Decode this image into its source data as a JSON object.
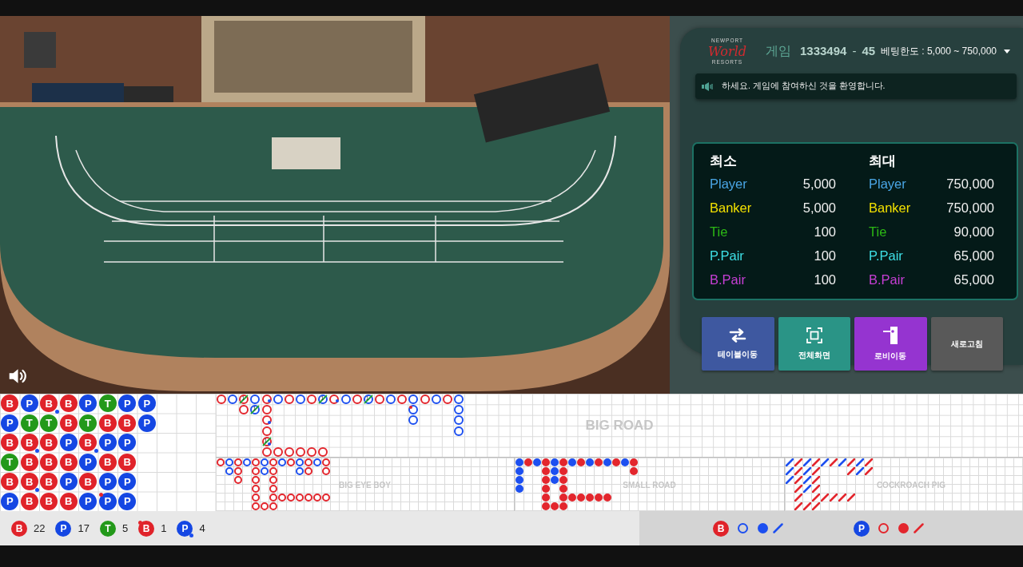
{
  "header": {
    "logo": {
      "top": "NEWPORT",
      "script": "World",
      "bottom": "RESORTS"
    },
    "game_label": "게임",
    "game_number": "1333494",
    "separator": "-",
    "round": "45",
    "bet_limit": "베팅한도 : 5,000 ~ 750,000"
  },
  "notice": {
    "text": "하세요. 게임에 참여하신 것을 환영합니다."
  },
  "limits": [
    {
      "heading": "최소",
      "rows": [
        {
          "label": "Player",
          "color": "#4aa6e6",
          "value": "5,000"
        },
        {
          "label": "Banker",
          "color": "#f2e000",
          "value": "5,000"
        },
        {
          "label": "Tie",
          "color": "#2cb815",
          "value": "100"
        },
        {
          "label": "P.Pair",
          "color": "#3ee0e6",
          "value": "100"
        },
        {
          "label": "B.Pair",
          "color": "#c83fd6",
          "value": "100"
        }
      ]
    },
    {
      "heading": "최대",
      "rows": [
        {
          "label": "Player",
          "color": "#4aa6e6",
          "value": "750,000"
        },
        {
          "label": "Banker",
          "color": "#f2e000",
          "value": "750,000"
        },
        {
          "label": "Tie",
          "color": "#2cb815",
          "value": "90,000"
        },
        {
          "label": "P.Pair",
          "color": "#3ee0e6",
          "value": "65,000"
        },
        {
          "label": "B.Pair",
          "color": "#c83fd6",
          "value": "65,000"
        }
      ]
    }
  ],
  "buttons": [
    {
      "label": "테이블이동",
      "kind": "swap",
      "color": "#3e58a0"
    },
    {
      "label": "전체화면",
      "kind": "fullscreen",
      "color": "#2a9486"
    },
    {
      "label": "로비이동",
      "kind": "exit",
      "color": "#9534d0"
    },
    {
      "label": "새로고침",
      "kind": "text",
      "color": "#595959"
    }
  ],
  "bead_road": {
    "columns": [
      [
        {
          "label": "B",
          "kind": "banker",
          "banker_pair": false,
          "player_pair": false
        },
        {
          "label": "P",
          "kind": "player",
          "banker_pair": false,
          "player_pair": false
        },
        {
          "label": "B",
          "kind": "banker",
          "banker_pair": false,
          "player_pair": false
        },
        {
          "label": "T",
          "kind": "tie",
          "banker_pair": false,
          "player_pair": false
        },
        {
          "label": "B",
          "kind": "banker",
          "banker_pair": false,
          "player_pair": false
        },
        {
          "label": "P",
          "kind": "player",
          "banker_pair": false,
          "player_pair": false
        }
      ],
      [
        {
          "label": "P",
          "kind": "player",
          "banker_pair": false,
          "player_pair": false
        },
        {
          "label": "T",
          "kind": "tie",
          "banker_pair": false,
          "player_pair": false
        },
        {
          "label": "B",
          "kind": "banker",
          "banker_pair": false,
          "player_pair": true
        },
        {
          "label": "B",
          "kind": "banker",
          "banker_pair": false,
          "player_pair": false
        },
        {
          "label": "B",
          "kind": "banker",
          "banker_pair": false,
          "player_pair": true
        },
        {
          "label": "B",
          "kind": "banker",
          "banker_pair": false,
          "player_pair": false
        }
      ],
      [
        {
          "label": "B",
          "kind": "banker",
          "banker_pair": false,
          "player_pair": true
        },
        {
          "label": "T",
          "kind": "tie",
          "banker_pair": false,
          "player_pair": false
        },
        {
          "label": "B",
          "kind": "banker",
          "banker_pair": false,
          "player_pair": false
        },
        {
          "label": "B",
          "kind": "banker",
          "banker_pair": false,
          "player_pair": false
        },
        {
          "label": "B",
          "kind": "banker",
          "banker_pair": false,
          "player_pair": false
        },
        {
          "label": "B",
          "kind": "banker",
          "banker_pair": false,
          "player_pair": false
        }
      ],
      [
        {
          "label": "B",
          "kind": "banker",
          "banker_pair": false,
          "player_pair": false
        },
        {
          "label": "B",
          "kind": "banker",
          "banker_pair": false,
          "player_pair": false
        },
        {
          "label": "P",
          "kind": "player",
          "banker_pair": false,
          "player_pair": false
        },
        {
          "label": "B",
          "kind": "banker",
          "banker_pair": false,
          "player_pair": false
        },
        {
          "label": "P",
          "kind": "player",
          "banker_pair": false,
          "player_pair": false
        },
        {
          "label": "B",
          "kind": "banker",
          "banker_pair": false,
          "player_pair": false
        }
      ],
      [
        {
          "label": "P",
          "kind": "player",
          "banker_pair": false,
          "player_pair": false
        },
        {
          "label": "T",
          "kind": "tie",
          "banker_pair": false,
          "player_pair": false
        },
        {
          "label": "B",
          "kind": "banker",
          "banker_pair": false,
          "player_pair": true
        },
        {
          "label": "P",
          "kind": "player",
          "banker_pair": false,
          "player_pair": false
        },
        {
          "label": "B",
          "kind": "banker",
          "banker_pair": false,
          "player_pair": false
        },
        {
          "label": "P",
          "kind": "player",
          "banker_pair": false,
          "player_pair": false
        }
      ],
      [
        {
          "label": "T",
          "kind": "tie",
          "banker_pair": false,
          "player_pair": false
        },
        {
          "label": "B",
          "kind": "banker",
          "banker_pair": false,
          "player_pair": false
        },
        {
          "label": "P",
          "kind": "player",
          "banker_pair": false,
          "player_pair": false
        },
        {
          "label": "B",
          "kind": "banker",
          "banker_pair": false,
          "player_pair": false
        },
        {
          "label": "P",
          "kind": "player",
          "banker_pair": false,
          "player_pair": false
        },
        {
          "label": "P",
          "kind": "player",
          "banker_pair": true,
          "player_pair": false
        }
      ],
      [
        {
          "label": "P",
          "kind": "player",
          "banker_pair": false,
          "player_pair": false
        },
        {
          "label": "B",
          "kind": "banker",
          "banker_pair": false,
          "player_pair": false
        },
        {
          "label": "P",
          "kind": "player",
          "banker_pair": false,
          "player_pair": false
        },
        {
          "label": "B",
          "kind": "banker",
          "banker_pair": false,
          "player_pair": false
        },
        {
          "label": "P",
          "kind": "player",
          "banker_pair": false,
          "player_pair": false
        },
        {
          "label": "P",
          "kind": "player",
          "banker_pair": false,
          "player_pair": false
        }
      ],
      [
        {
          "label": "P",
          "kind": "player",
          "banker_pair": false,
          "player_pair": false
        },
        {
          "label": "P",
          "kind": "player",
          "banker_pair": false,
          "player_pair": false
        }
      ]
    ]
  },
  "big_road": {
    "label": "BIG ROAD",
    "columns": [
      [
        {
          "kind": "banker",
          "banker_pair": false,
          "player_pair": false
        }
      ],
      [
        {
          "kind": "player",
          "banker_pair": false,
          "player_pair": false
        }
      ],
      [
        {
          "kind": "banker",
          "tie": "1",
          "banker_pair": false,
          "player_pair": false
        },
        {
          "kind": "banker",
          "banker_pair": false,
          "player_pair": false
        }
      ],
      [
        {
          "kind": "player",
          "banker_pair": false,
          "player_pair": false
        },
        {
          "kind": "player",
          "tie": "1",
          "banker_pair": false,
          "player_pair": false
        }
      ],
      [
        {
          "kind": "banker",
          "banker_pair": false,
          "player_pair": true
        },
        {
          "kind": "banker",
          "banker_pair": false,
          "player_pair": false
        },
        {
          "kind": "banker",
          "banker_pair": false,
          "player_pair": true
        },
        {
          "kind": "banker",
          "banker_pair": false,
          "player_pair": false
        },
        {
          "kind": "banker",
          "tie": "1",
          "banker_pair": false,
          "player_pair": true
        },
        {
          "kind": "banker",
          "banker_pair": false,
          "player_pair": false
        },
        {
          "kind": "banker",
          "banker_pair": false,
          "player_pair": false
        },
        {
          "kind": "banker",
          "banker_pair": false,
          "player_pair": false
        },
        {
          "kind": "banker",
          "banker_pair": false,
          "player_pair": false
        },
        {
          "kind": "banker",
          "banker_pair": false,
          "player_pair": false
        },
        {
          "kind": "banker",
          "banker_pair": false,
          "player_pair": false
        }
      ],
      [
        {
          "kind": "player",
          "banker_pair": false,
          "player_pair": false
        }
      ],
      [
        {
          "kind": "banker",
          "banker_pair": false,
          "player_pair": false
        }
      ],
      [
        {
          "kind": "player",
          "banker_pair": false,
          "player_pair": false
        }
      ],
      [
        {
          "kind": "banker",
          "banker_pair": false,
          "player_pair": false
        }
      ],
      [
        {
          "kind": "player",
          "tie": "1",
          "banker_pair": false,
          "player_pair": false
        }
      ],
      [
        {
          "kind": "banker",
          "banker_pair": false,
          "player_pair": true
        }
      ],
      [
        {
          "kind": "player",
          "banker_pair": false,
          "player_pair": false
        }
      ],
      [
        {
          "kind": "banker",
          "banker_pair": false,
          "player_pair": false
        }
      ],
      [
        {
          "kind": "player",
          "tie": "1",
          "banker_pair": false,
          "player_pair": false
        }
      ],
      [
        {
          "kind": "banker",
          "banker_pair": false,
          "player_pair": false
        }
      ],
      [
        {
          "kind": "player",
          "banker_pair": false,
          "player_pair": false
        }
      ],
      [
        {
          "kind": "banker",
          "banker_pair": false,
          "player_pair": false
        }
      ],
      [
        {
          "kind": "player",
          "banker_pair": false,
          "player_pair": false
        },
        {
          "kind": "player",
          "banker_pair": true,
          "player_pair": false
        },
        {
          "kind": "player",
          "banker_pair": false,
          "player_pair": false
        }
      ],
      [
        {
          "kind": "banker",
          "banker_pair": false,
          "player_pair": false
        }
      ],
      [
        {
          "kind": "player",
          "banker_pair": false,
          "player_pair": false
        }
      ],
      [
        {
          "kind": "banker",
          "banker_pair": false,
          "player_pair": false
        }
      ],
      [
        {
          "kind": "player",
          "banker_pair": false,
          "player_pair": false
        },
        {
          "kind": "player",
          "banker_pair": false,
          "player_pair": false
        },
        {
          "kind": "player",
          "banker_pair": false,
          "player_pair": false
        },
        {
          "kind": "player",
          "banker_pair": false,
          "player_pair": false
        }
      ]
    ]
  },
  "big_eye_boy": {
    "label": "BIG EYE BOY",
    "columns": [
      [
        {
          "color": "#e3262d"
        }
      ],
      [
        {
          "color": "#1c4ff0"
        },
        {
          "color": "#1c4ff0"
        }
      ],
      [
        {
          "color": "#e3262d"
        },
        {
          "color": "#e3262d"
        },
        {
          "color": "#e3262d"
        }
      ],
      [
        {
          "color": "#1c4ff0"
        }
      ],
      [
        {
          "color": "#e3262d"
        },
        {
          "color": "#e3262d"
        },
        {
          "color": "#e3262d"
        },
        {
          "color": "#e3262d"
        },
        {
          "color": "#e3262d"
        },
        {
          "color": "#e3262d"
        },
        {
          "color": "#e3262d"
        },
        {
          "color": "#e3262d"
        }
      ],
      [
        {
          "color": "#1c4ff0"
        },
        {
          "color": "#1c4ff0"
        }
      ],
      [
        {
          "color": "#e3262d"
        },
        {
          "color": "#e3262d"
        },
        {
          "color": "#e3262d"
        },
        {
          "color": "#e3262d"
        },
        {
          "color": "#e3262d"
        },
        {
          "color": "#e3262d"
        },
        {
          "color": "#e3262d"
        },
        {
          "color": "#e3262d"
        },
        {
          "color": "#e3262d"
        },
        {
          "color": "#e3262d"
        },
        {
          "color": "#e3262d"
        }
      ],
      [
        {
          "color": "#1c4ff0"
        }
      ],
      [
        {
          "color": "#e3262d"
        }
      ],
      [
        {
          "color": "#1c4ff0"
        },
        {
          "color": "#1c4ff0"
        }
      ],
      [
        {
          "color": "#e3262d"
        },
        {
          "color": "#e3262d"
        }
      ],
      [
        {
          "color": "#1c4ff0"
        }
      ],
      [
        {
          "color": "#e3262d"
        },
        {
          "color": "#e3262d"
        }
      ]
    ]
  },
  "small_road": {
    "label": "SMALL ROAD",
    "columns": [
      [
        {
          "color": "#1c4ff0"
        },
        {
          "color": "#1c4ff0"
        },
        {
          "color": "#1c4ff0"
        },
        {
          "color": "#1c4ff0"
        }
      ],
      [
        {
          "color": "#e3262d"
        }
      ],
      [
        {
          "color": "#1c4ff0"
        }
      ],
      [
        {
          "color": "#e3262d"
        },
        {
          "color": "#e3262d"
        },
        {
          "color": "#e3262d"
        },
        {
          "color": "#e3262d"
        },
        {
          "color": "#e3262d"
        },
        {
          "color": "#e3262d"
        },
        {
          "color": "#e3262d"
        },
        {
          "color": "#e3262d"
        }
      ],
      [
        {
          "color": "#1c4ff0"
        },
        {
          "color": "#1c4ff0"
        },
        {
          "color": "#1c4ff0"
        }
      ],
      [
        {
          "color": "#e3262d"
        },
        {
          "color": "#e3262d"
        },
        {
          "color": "#e3262d"
        },
        {
          "color": "#e3262d"
        },
        {
          "color": "#e3262d"
        },
        {
          "color": "#e3262d"
        },
        {
          "color": "#e3262d"
        },
        {
          "color": "#e3262d"
        },
        {
          "color": "#e3262d"
        },
        {
          "color": "#e3262d"
        }
      ],
      [
        {
          "color": "#1c4ff0"
        }
      ],
      [
        {
          "color": "#e3262d"
        }
      ],
      [
        {
          "color": "#1c4ff0"
        }
      ],
      [
        {
          "color": "#e3262d"
        }
      ],
      [
        {
          "color": "#1c4ff0"
        }
      ],
      [
        {
          "color": "#e3262d"
        }
      ],
      [
        {
          "color": "#1c4ff0"
        }
      ],
      [
        {
          "color": "#e3262d"
        },
        {
          "color": "#e3262d"
        }
      ]
    ]
  },
  "cockroach_pig": {
    "label": "COCKROACH PIG",
    "columns": [
      [
        {
          "color": "#1c4ff0"
        },
        {
          "color": "#1c4ff0"
        },
        {
          "color": "#1c4ff0"
        }
      ],
      [
        {
          "color": "#e3262d"
        },
        {
          "color": "#e3262d"
        },
        {
          "color": "#e3262d"
        },
        {
          "color": "#e3262d"
        },
        {
          "color": "#e3262d"
        },
        {
          "color": "#e3262d"
        },
        {
          "color": "#e3262d"
        },
        {
          "color": "#e3262d"
        }
      ],
      [
        {
          "color": "#1c4ff0"
        },
        {
          "color": "#1c4ff0"
        },
        {
          "color": "#1c4ff0"
        },
        {
          "color": "#1c4ff0"
        }
      ],
      [
        {
          "color": "#e3262d"
        },
        {
          "color": "#e3262d"
        },
        {
          "color": "#e3262d"
        },
        {
          "color": "#e3262d"
        },
        {
          "color": "#e3262d"
        },
        {
          "color": "#e3262d"
        },
        {
          "color": "#e3262d"
        },
        {
          "color": "#e3262d"
        },
        {
          "color": "#e3262d"
        }
      ],
      [
        {
          "color": "#1c4ff0"
        }
      ],
      [
        {
          "color": "#e3262d"
        }
      ],
      [
        {
          "color": "#1c4ff0"
        }
      ],
      [
        {
          "color": "#e3262d"
        },
        {
          "color": "#e3262d"
        }
      ],
      [
        {
          "color": "#1c4ff0"
        },
        {
          "color": "#1c4ff0"
        }
      ],
      [
        {
          "color": "#e3262d"
        },
        {
          "color": "#e3262d"
        }
      ]
    ]
  },
  "stats": [
    {
      "label": "B",
      "kind": "banker",
      "count": "22"
    },
    {
      "label": "P",
      "kind": "player",
      "count": "17"
    },
    {
      "label": "T",
      "kind": "tie",
      "count": "5"
    },
    {
      "label": "B",
      "kind": "banker_pair",
      "count": "1"
    },
    {
      "label": "P",
      "kind": "player_pair",
      "count": "4"
    }
  ],
  "predictions": [
    {
      "label": "B",
      "kind": "banker",
      "marks": [
        {
          "kind": "ring",
          "color": "#1c4ff0"
        },
        {
          "kind": "dot",
          "color": "#1c4ff0"
        },
        {
          "kind": "slash",
          "color": "#1c4ff0"
        }
      ]
    },
    {
      "label": "P",
      "kind": "player",
      "marks": [
        {
          "kind": "ring",
          "color": "#e3262d"
        },
        {
          "kind": "dot",
          "color": "#e3262d"
        },
        {
          "kind": "slash",
          "color": "#e3262d"
        }
      ]
    }
  ]
}
